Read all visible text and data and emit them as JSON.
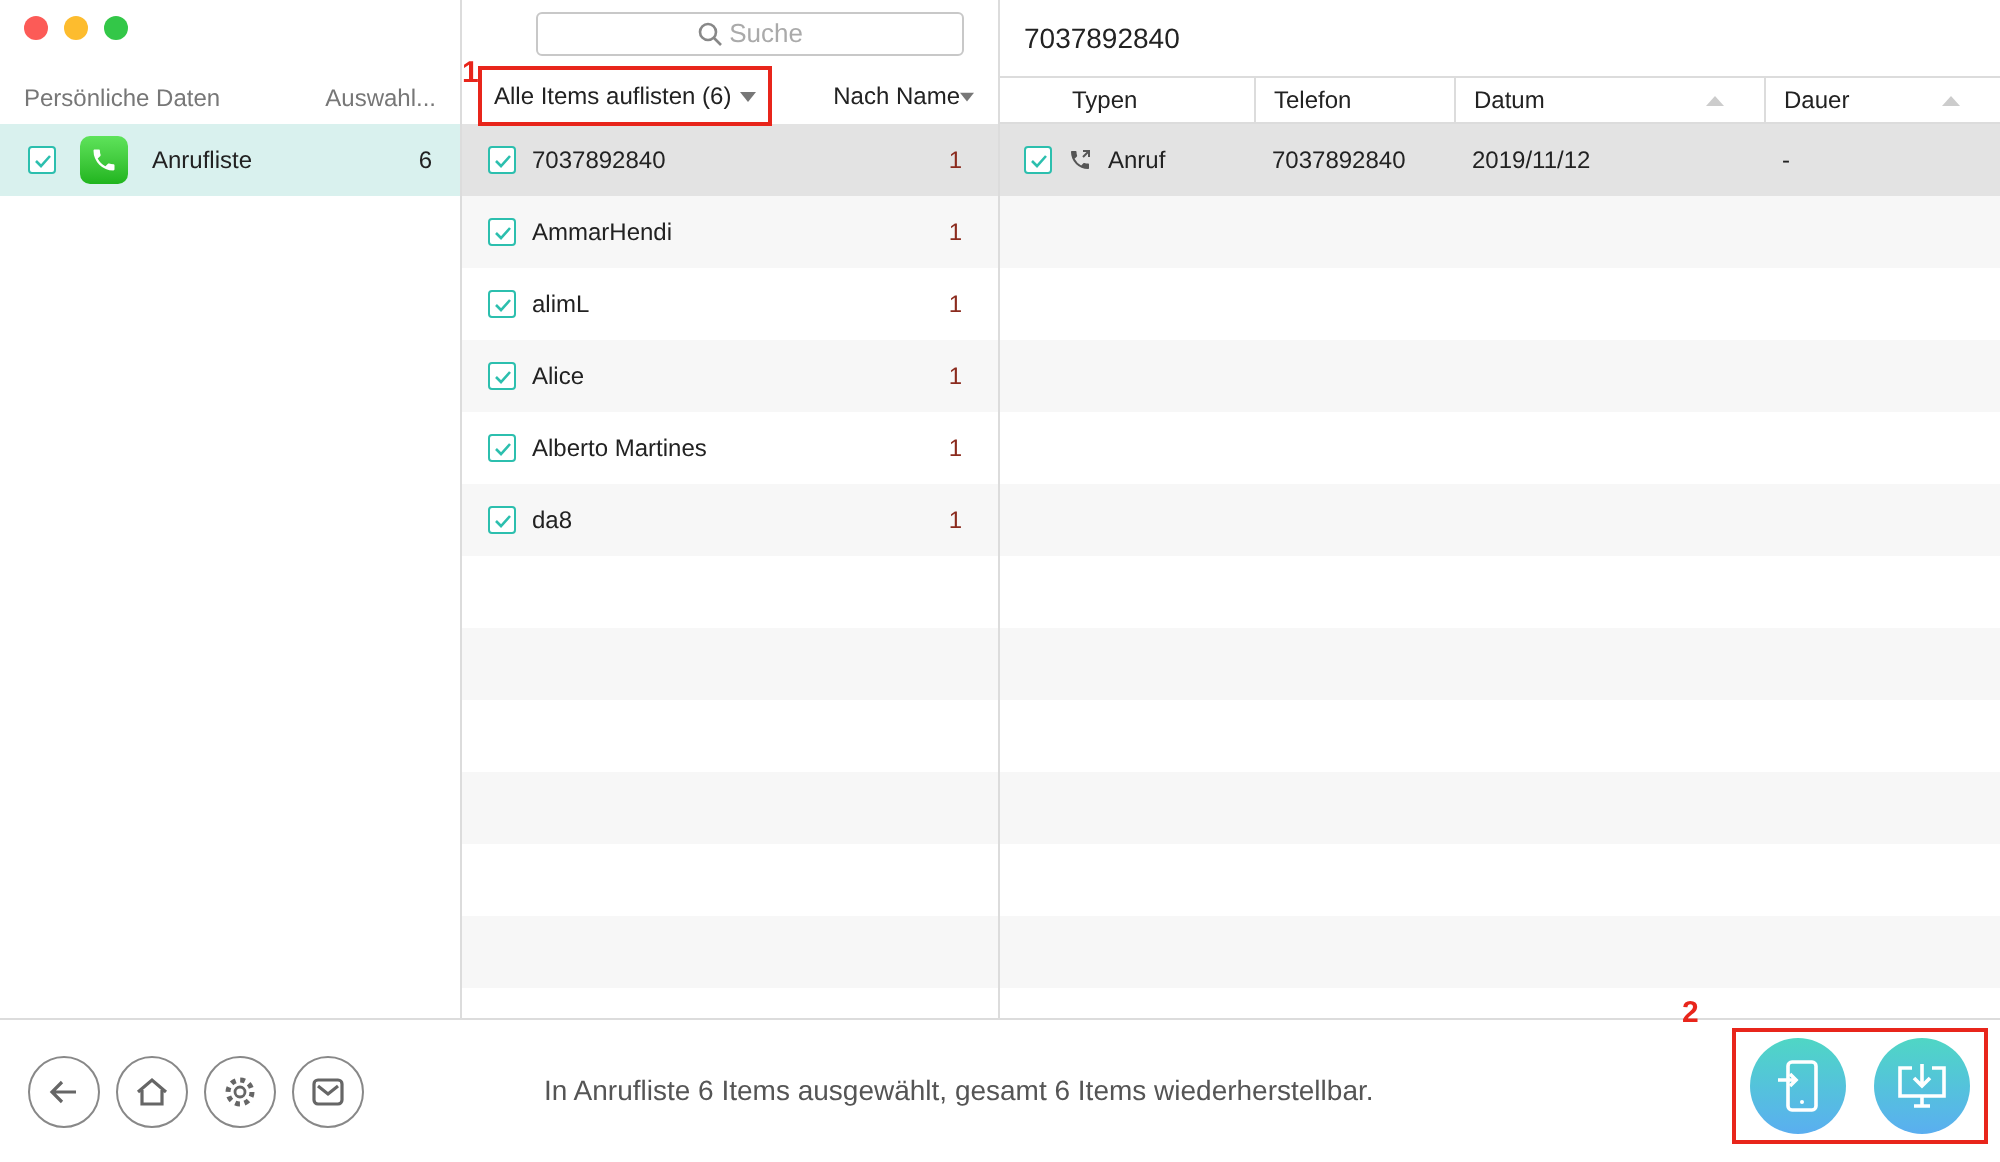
{
  "sidebar": {
    "header": {
      "label": "Persönliche Daten",
      "count_label": "Auswahl..."
    },
    "items": [
      {
        "label": "Anrufliste",
        "count": "6",
        "checked": true,
        "selected": true
      }
    ]
  },
  "search": {
    "placeholder": "Suche"
  },
  "list": {
    "filter": {
      "label": "Alle Items auflisten (6)",
      "annotation": "1"
    },
    "sort": "Nach Name",
    "items": [
      {
        "name": "7037892840",
        "count": "1",
        "checked": true,
        "selected": true
      },
      {
        "name": "AmmarHendi",
        "count": "1",
        "checked": true,
        "selected": false
      },
      {
        "name": "alimL",
        "count": "1",
        "checked": true,
        "selected": false
      },
      {
        "name": "Alice",
        "count": "1",
        "checked": true,
        "selected": false
      },
      {
        "name": "Alberto Martines",
        "count": "1",
        "checked": true,
        "selected": false
      },
      {
        "name": "da8",
        "count": "1",
        "checked": true,
        "selected": false
      }
    ]
  },
  "detail": {
    "title": "7037892840",
    "columns": [
      "Typen",
      "Telefon",
      "Datum",
      "Dauer"
    ],
    "rows": [
      {
        "checked": true,
        "selected": true,
        "cells": [
          "Anruf",
          "7037892840",
          "2019/11/12",
          "-"
        ]
      }
    ]
  },
  "status_bar": {
    "text": "In Anrufliste 6 Items ausgewählt, gesamt 6 Items wiederherstellbar.",
    "actions_annotation": "2"
  }
}
